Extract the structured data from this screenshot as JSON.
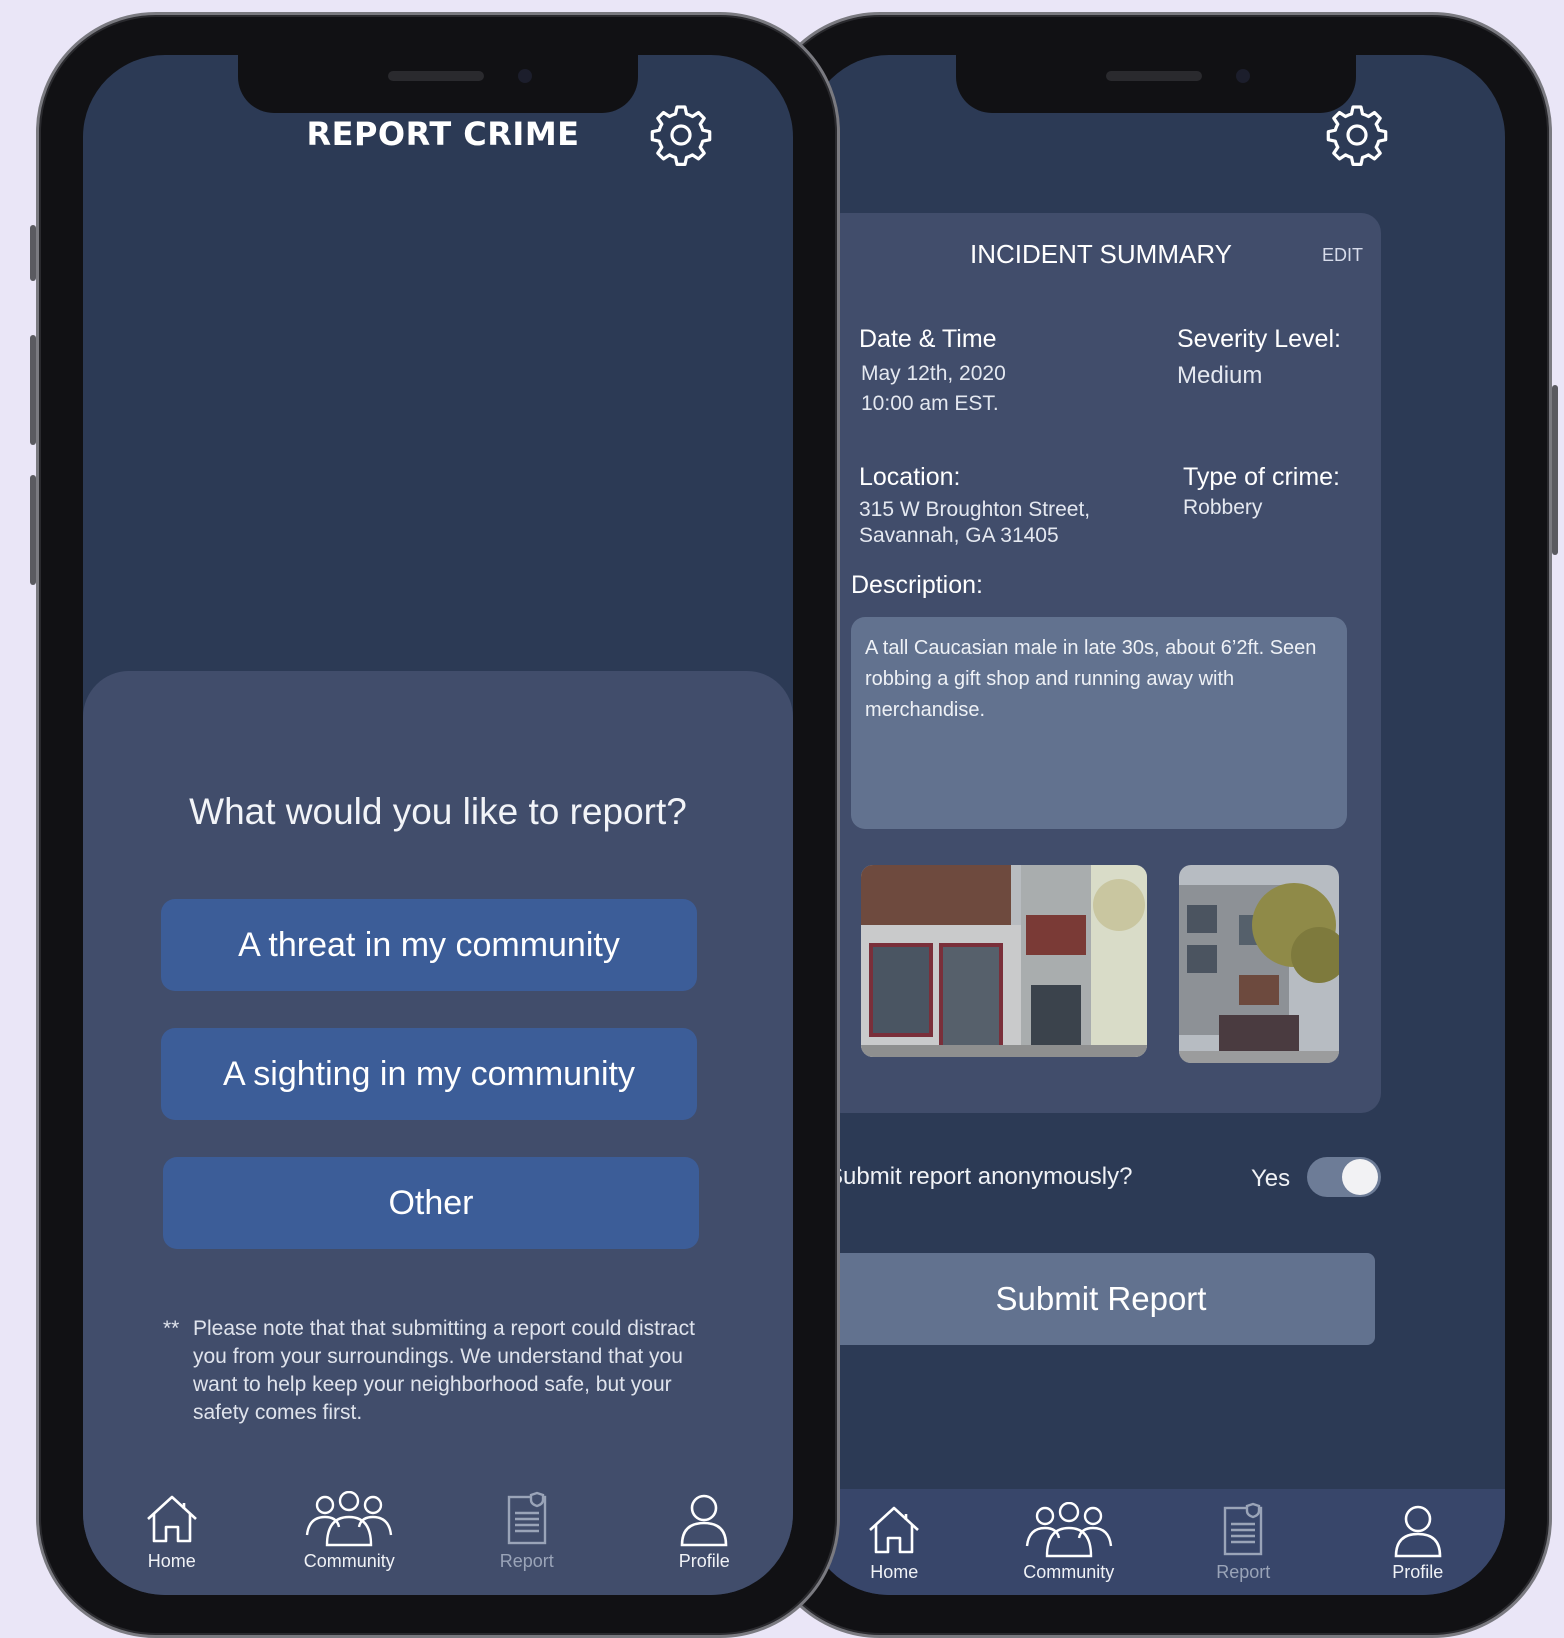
{
  "left_screen": {
    "title": "REPORT CRIME",
    "question": "What would you like to report?",
    "options": [
      {
        "label": "A threat in my community"
      },
      {
        "label": "A sighting in my community"
      },
      {
        "label": "Other"
      }
    ],
    "note": {
      "prefix": "**",
      "text": "Please note that that submitting a report could distract you from your surroundings. We understand that you want to help keep your neighborhood safe, but your safety comes first."
    }
  },
  "right_screen": {
    "back_icon": "‹",
    "summary": {
      "title": "INCIDENT SUMMARY",
      "edit_label": "EDIT",
      "date_label": "Date & Time",
      "date_value_1": "May 12th, 2020",
      "date_value_2": "10:00 am EST.",
      "severity_label": "Severity Level:",
      "severity_value": "Medium",
      "location_label": "Location:",
      "location_value_1": "315 W Broughton Street,",
      "location_value_2": "Savannah, GA 31405",
      "type_label": "Type of crime:",
      "type_value": "Robbery",
      "description_label": "Description:",
      "description_value": "A tall Caucasian male in late 30s, about 6’2ft. Seen robbing a gift shop and running away with merchandise."
    },
    "anonymous": {
      "label": "Submit report anonymously?",
      "value_label": "Yes",
      "enabled": true
    },
    "submit_label": "Submit Report"
  },
  "nav": {
    "items": [
      {
        "label": "Home",
        "icon": "home-icon"
      },
      {
        "label": "Community",
        "icon": "community-icon"
      },
      {
        "label": "Report",
        "icon": "report-icon"
      },
      {
        "label": "Profile",
        "icon": "profile-icon"
      }
    ]
  },
  "colors": {
    "background": "#eae6f7",
    "screen": "#2c3a55",
    "panel": "#414d6b",
    "button": "#3c5d98",
    "input": "#62728f"
  }
}
